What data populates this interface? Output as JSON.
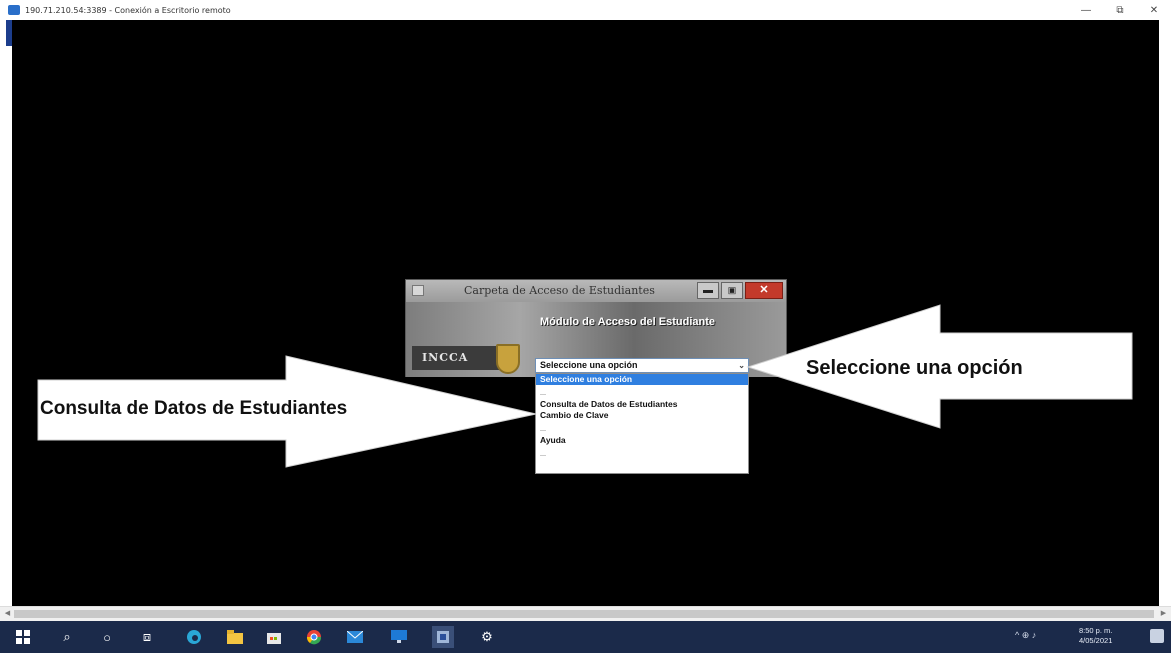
{
  "window": {
    "title": "190.71.210.54:3389 - Conexión a Escritorio remoto",
    "minimize_glyph": "—",
    "restore_glyph": "⧉",
    "close_glyph": "✕"
  },
  "dialog": {
    "title": "Carpeta de Acceso de Estudiantes",
    "heading": "Módulo de Acceso del Estudiante",
    "logo_text": "INCCA",
    "minimize_glyph": "▬",
    "maximize_glyph": "▣",
    "close_glyph": "✕"
  },
  "select": {
    "value": "Seleccione una opción",
    "chevron": "⌄",
    "options": [
      {
        "label": "Seleccione una opción"
      },
      {
        "label": "Consulta de Datos de Estudiantes"
      },
      {
        "label": "Cambio de Clave"
      },
      {
        "label": "Ayuda"
      }
    ],
    "separator": "---"
  },
  "callouts": {
    "left": "Consulta de Datos de Estudiantes",
    "right": "Seleccione una opción"
  },
  "taskbar": {
    "icons": [
      "windows-start-icon",
      "search-icon",
      "cortana-icon",
      "task-view-icon",
      "edge-icon",
      "file-explorer-icon",
      "store-icon",
      "chrome-icon",
      "mail-icon",
      "remote-desktop-icon",
      "network-app-icon",
      "settings-icon"
    ],
    "tray_text": "^  ⊕  ♪",
    "clock_time": "8:50 p. m.",
    "clock_date": "4/05/2021"
  },
  "colors": {
    "remote_bg": "#000000",
    "taskbar": "#1b2a4a",
    "select_highlight": "#2f7fe0",
    "close_red": "#c33a2b"
  }
}
